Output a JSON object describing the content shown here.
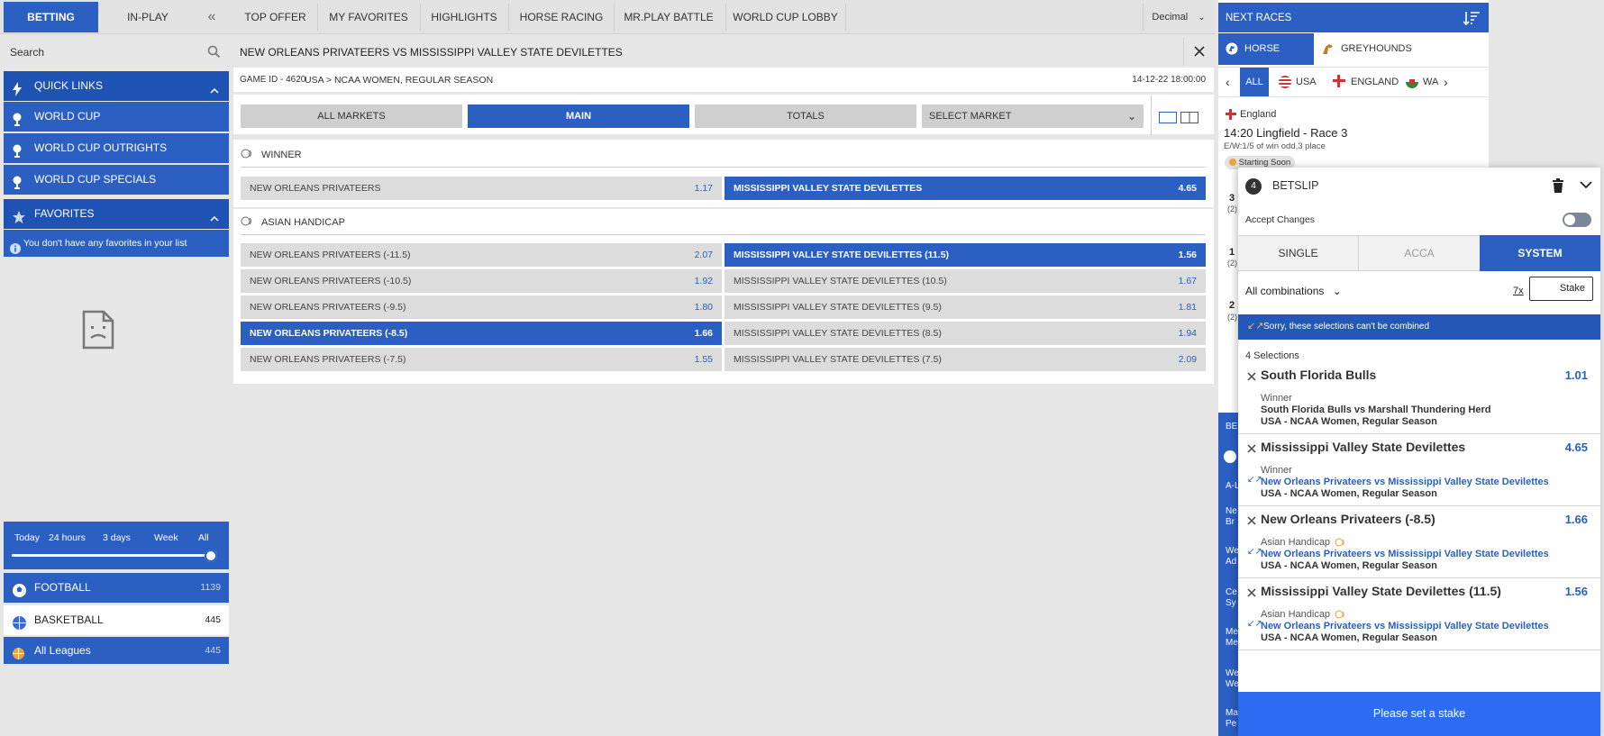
{
  "top": {
    "betting": "BETTING",
    "inplay": "IN-PLAY",
    "nav": [
      "TOP OFFER",
      "MY FAVORITES",
      "HIGHLIGHTS",
      "HORSE RACING",
      "MR.PLAY BATTLE",
      "WORLD CUP LOBBY"
    ],
    "odds_format": "Decimal"
  },
  "left": {
    "search_placeholder": "Search",
    "quick_links": "QUICK LINKS",
    "items": [
      "WORLD CUP",
      "WORLD CUP OUTRIGHTS",
      "WORLD CUP SPECIALS"
    ],
    "favorites": "FAVORITES",
    "no_favorites": "You don't have any favorites in your list",
    "time_filters": [
      "Today",
      "24 hours",
      "3 days",
      "Week",
      "All"
    ],
    "sports": [
      {
        "name": "FOOTBALL",
        "count": "1139"
      },
      {
        "name": "BASKETBALL",
        "count": "445"
      },
      {
        "name": "All Leagues",
        "count": "445"
      }
    ]
  },
  "match": {
    "title": "NEW ORLEANS PRIVATEERS VS MISSISSIPPI VALLEY STATE DEVILETTES",
    "game_id": "GAME ID - 4620",
    "breadcrumb": "USA > NCAA WOMEN, REGULAR SEASON",
    "datetime": "14-12-22 18:00:00",
    "tabs": [
      "ALL MARKETS",
      "MAIN",
      "TOTALS",
      "SELECT MARKET"
    ],
    "winner_title": "WINNER",
    "winner": [
      {
        "name": "NEW ORLEANS PRIVATEERS",
        "odd": "1.17"
      },
      {
        "name": "MISSISSIPPI VALLEY STATE DEVILETTES",
        "odd": "4.65"
      }
    ],
    "handicap_title": "ASIAN HANDICAP",
    "handicap": [
      {
        "l": "NEW ORLEANS PRIVATEERS (-11.5)",
        "lo": "2.07",
        "r": "MISSISSIPPI VALLEY STATE DEVILETTES (11.5)",
        "ro": "1.56"
      },
      {
        "l": "NEW ORLEANS PRIVATEERS (-10.5)",
        "lo": "1.92",
        "r": "MISSISSIPPI VALLEY STATE DEVILETTES (10.5)",
        "ro": "1.67"
      },
      {
        "l": "NEW ORLEANS PRIVATEERS (-9.5)",
        "lo": "1.80",
        "r": "MISSISSIPPI VALLEY STATE DEVILETTES (9.5)",
        "ro": "1.81"
      },
      {
        "l": "NEW ORLEANS PRIVATEERS (-8.5)",
        "lo": "1.66",
        "r": "MISSISSIPPI VALLEY STATE DEVILETTES (8.5)",
        "ro": "1.94"
      },
      {
        "l": "NEW ORLEANS PRIVATEERS (-7.5)",
        "lo": "1.55",
        "r": "MISSISSIPPI VALLEY STATE DEVILETTES (7.5)",
        "ro": "2.09"
      }
    ]
  },
  "races": {
    "header": "NEXT RACES",
    "horse": "HORSE RACING",
    "grey": "GREYHOUNDS",
    "filters": [
      "ALL",
      "USA",
      "ENGLAND",
      "WA"
    ],
    "country": "England",
    "race": "14:20 Lingfield - Race 3",
    "terms": "E/W:1/5 of win odd,3 place",
    "status": "Starting Soon",
    "partial": [
      "3",
      "(2)",
      "1",
      "(2)",
      "2",
      "(2)"
    ],
    "bet_partial": "BE",
    "side_partial": [
      "A-L",
      "Ne Br",
      "We Ad",
      "Ce Sy",
      "Me Me",
      "We We",
      "Ma Pe"
    ]
  },
  "betslip": {
    "count": "4",
    "title": "BETSLIP",
    "accept_changes": "Accept Changes",
    "tabs": [
      "SINGLE",
      "ACCA",
      "SYSTEM"
    ],
    "combinations": "All combinations",
    "multiplier": "7x",
    "stake_placeholder": "Stake",
    "warning": "Sorry, these selections can't be combined",
    "selections_label": "4 Selections",
    "selections": [
      {
        "name": "South Florida Bulls",
        "odd": "1.01",
        "market": "Winner",
        "event": "South Florida Bulls vs Marshall Thundering Herd",
        "league": "USA - NCAA Women, Regular Season"
      },
      {
        "name": "Mississippi Valley State Devilettes",
        "odd": "4.65",
        "market": "Winner",
        "event": "New Orleans Privateers vs Mississippi Valley State Devilettes",
        "league": "USA - NCAA Women, Regular Season"
      },
      {
        "name": "New Orleans Privateers (-8.5)",
        "odd": "1.66",
        "market": "Asian Handicap",
        "event": "New Orleans Privateers vs Mississippi Valley State Devilettes",
        "league": "USA - NCAA Women, Regular Season"
      },
      {
        "name": "Mississippi Valley State Devilettes (11.5)",
        "odd": "1.56",
        "market": "Asian Handicap",
        "event": "New Orleans Privateers vs Mississippi Valley State Devilettes",
        "league": "USA - NCAA Women, Regular Season"
      }
    ],
    "cta": "Please set a stake"
  },
  "colors": {
    "brand": "#2b5fc1",
    "dark": "#1e4fa8",
    "warn": "#2458b6"
  }
}
